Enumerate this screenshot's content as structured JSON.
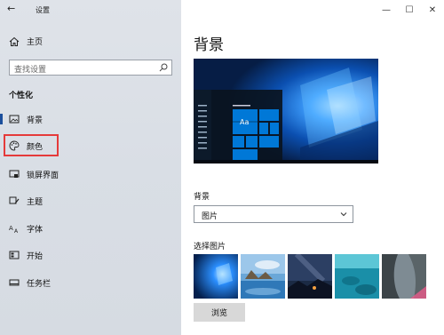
{
  "window": {
    "back_label": "←",
    "title": "设置",
    "min_label": "—",
    "max_label": "☐",
    "close_label": "✕"
  },
  "sidebar": {
    "home": "主页",
    "search_placeholder": "查找设置",
    "section_title": "个性化",
    "items": [
      {
        "label": "背景",
        "icon": "picture-icon",
        "active": true
      },
      {
        "label": "颜色",
        "icon": "palette-icon",
        "highlighted": true
      },
      {
        "label": "锁屏界面",
        "icon": "lock-screen-icon"
      },
      {
        "label": "主题",
        "icon": "brush-icon"
      },
      {
        "label": "字体",
        "icon": "font-icon"
      },
      {
        "label": "开始",
        "icon": "start-icon"
      },
      {
        "label": "任务栏",
        "icon": "taskbar-icon"
      }
    ]
  },
  "main": {
    "title": "背景",
    "preview_tile_label": "Aa",
    "background_label": "背景",
    "background_select_value": "图片",
    "choose_picture_label": "选择图片",
    "browse_label": "浏览"
  },
  "colors": {
    "accent": "#1b4f9c",
    "highlight_box": "#e53a3a",
    "preview_tile": "#0078d7"
  }
}
